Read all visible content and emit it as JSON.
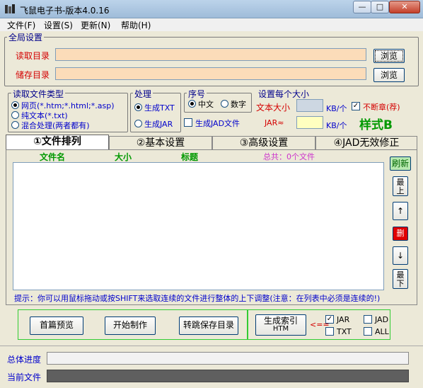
{
  "window": {
    "title": "飞鼠电子书-版本4.0.16",
    "minimize": "—",
    "maximize": "□",
    "close": "✕"
  },
  "menu": [
    {
      "label": "文件(F)"
    },
    {
      "label": "设置(S)"
    },
    {
      "label": "更新(N)"
    },
    {
      "label": "帮助(H)"
    }
  ],
  "global": {
    "group_label": "全局设置",
    "read_dir_label": "读取目录",
    "read_dir_value": "",
    "browse1": "浏览",
    "save_dir_label": "储存目录",
    "save_dir_value": "",
    "browse2": "浏览"
  },
  "read_type": {
    "label": "读取文件类型",
    "options": [
      "网页(*.htm;*.html;*.asp)",
      "纯文本(*.txt)",
      "混合处理(两者都有)"
    ],
    "selected": 0
  },
  "process": {
    "label": "处理",
    "options": [
      "生成TXT",
      "生成JAR"
    ],
    "selected": 0
  },
  "seq": {
    "label": "序号",
    "options": [
      "中文",
      "数字"
    ],
    "selected": 0,
    "gen_jad": "生成JAD文件"
  },
  "size": {
    "label": "设置每个大小",
    "text_size": "文本大小",
    "text_unit": "KB/个",
    "no_break": "不断章(荐)",
    "jar_label": "JAR≈",
    "jar_unit": "KB/个",
    "style": "样式B"
  },
  "tabs": [
    "①文件排列",
    "②基本设置",
    "③高级设置",
    "④JAD无效修正"
  ],
  "filelist": {
    "col_name": "文件名",
    "col_size": "大小",
    "col_title": "标题",
    "total": "总共：0个文件"
  },
  "side": {
    "refresh": "刷新",
    "top": "最上",
    "up": "↑",
    "del": "删",
    "down": "↓",
    "bottom": "最下"
  },
  "hint": "提示：你可以用鼠标拖动或按SHIFT来选取连续的文件进行整体的上下调整(注意：在列表中必须是连续的!)",
  "actions": {
    "preview": "首篇预览",
    "start": "开始制作",
    "jump": "转跳保存目录",
    "index": "生成索引",
    "index2": "HTM",
    "arrow": "<=="
  },
  "outputs": {
    "jar": "JAR",
    "jad": "JAD",
    "txt": "TXT",
    "all": "ALL"
  },
  "progress": {
    "total_label": "总体进度",
    "total_value": 0,
    "current_label": "当前文件",
    "current_value": 0
  },
  "colors": {
    "red": "#d40000",
    "blue": "#0000cc",
    "green": "#009900",
    "input_bg": "#fbdcb9"
  }
}
